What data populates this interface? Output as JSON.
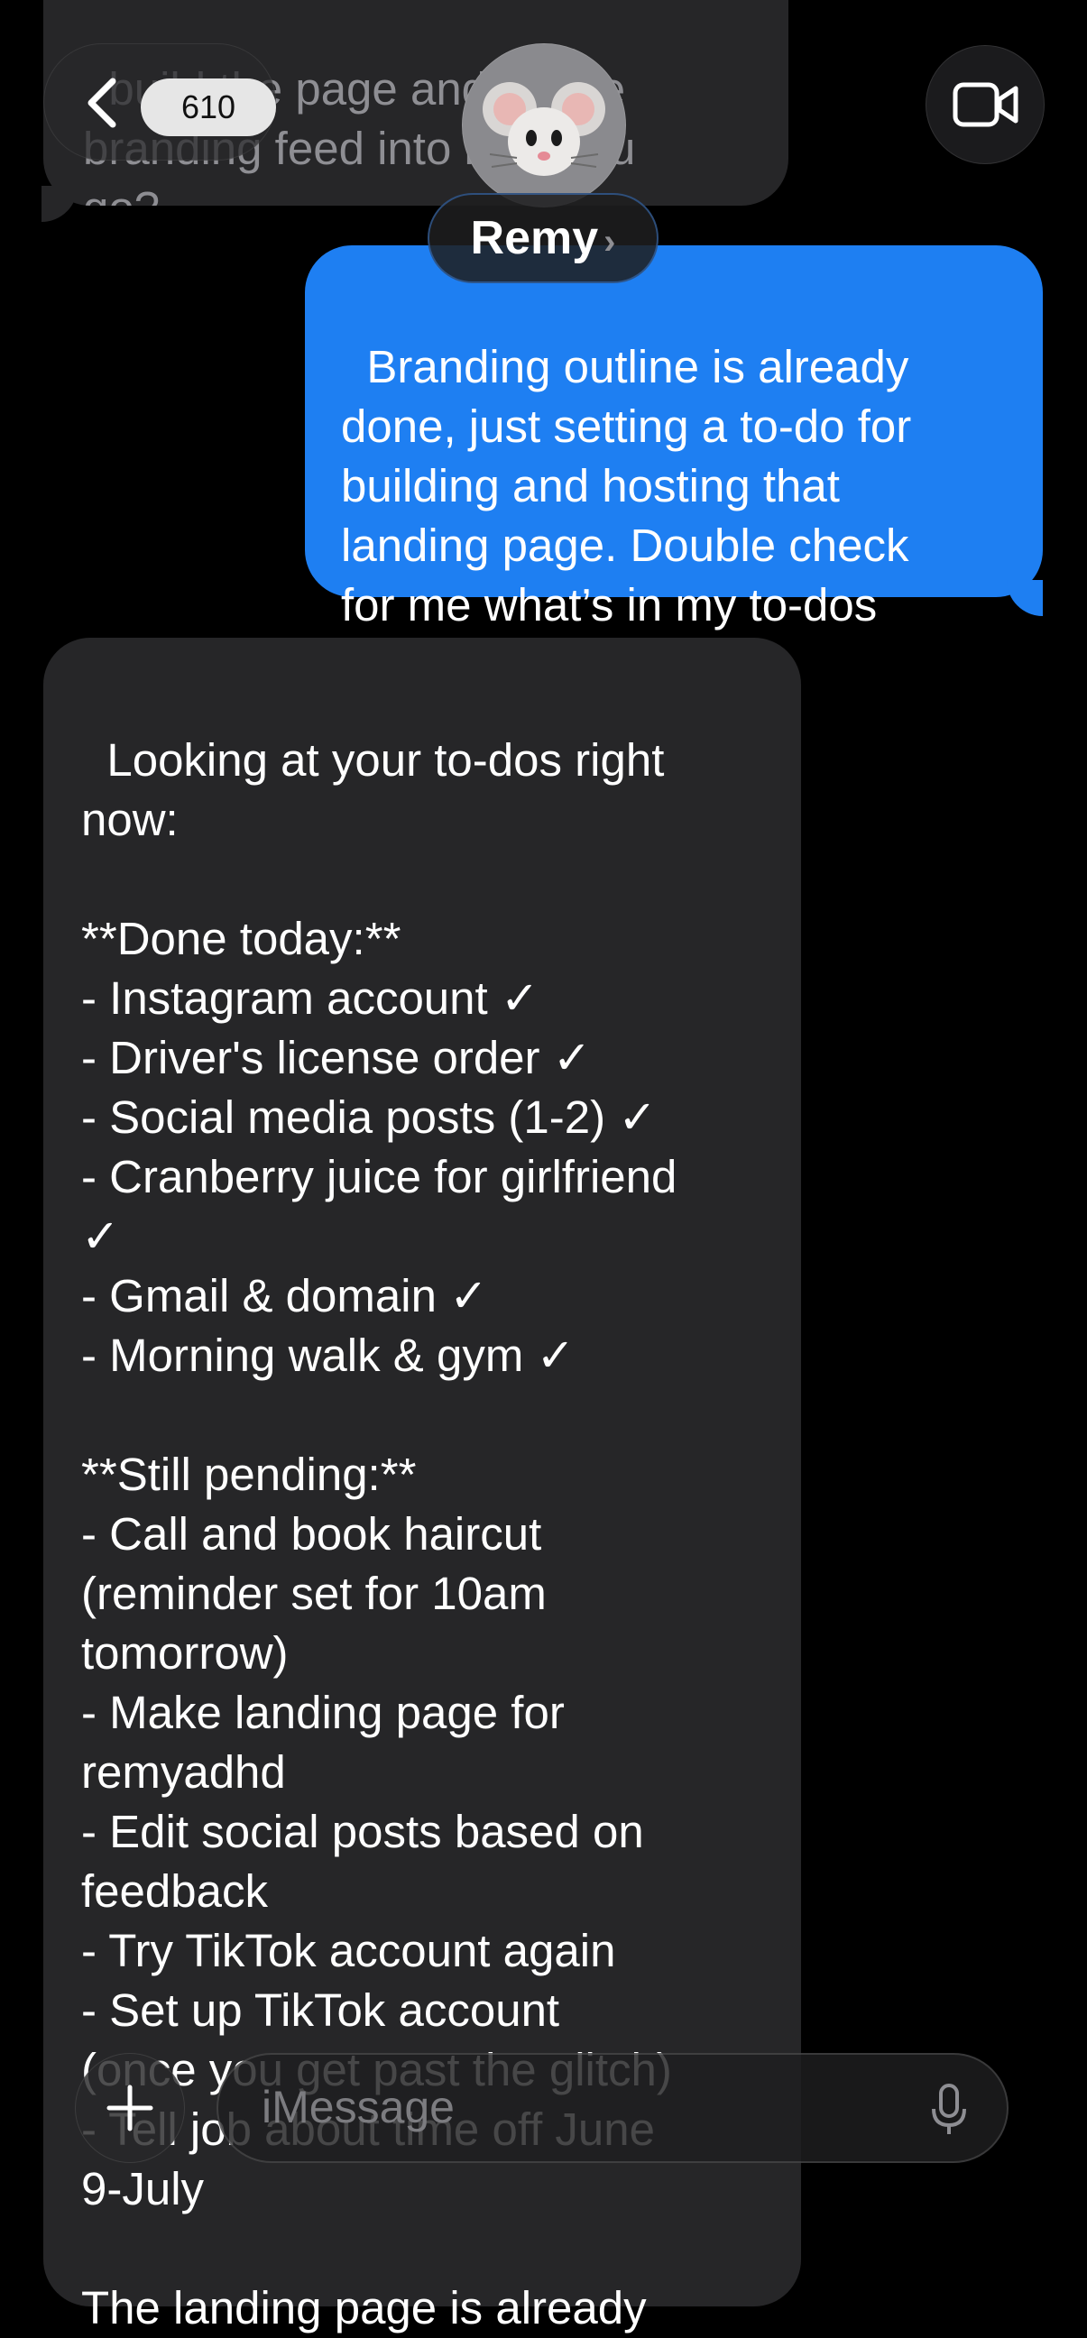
{
  "header": {
    "back_label": "<",
    "unread_count": "610",
    "contact_name": "Remy",
    "contact_chevron": "›",
    "avatar_icon": "mouse-avatar",
    "video_icon": "video-camera-icon"
  },
  "messages": [
    {
      "sender": "contact",
      "text": "build the page and let the\nbranding feed into it as you\ngo?"
    },
    {
      "sender": "me",
      "text": "Branding outline is already\ndone, just setting a to-do for\nbuilding and hosting that\nlanding page. Double check\nfor me what’s in my to-dos"
    },
    {
      "sender": "contact",
      "text": "Looking at your to-dos right\nnow:\n\n**Done today:**\n- Instagram account ✓\n- Driver's license order ✓\n- Social media posts (1-2) ✓\n- Cranberry juice for girlfriend\n✓\n- Gmail & domain ✓\n- Morning walk & gym ✓\n\n**Still pending:**\n- Call and book haircut\n(reminder set for 10am\ntomorrow)\n- Make landing page for\nremyadhd\n- Edit social posts based on\nfeedback\n- Try TikTok account again\n- Set up TikTok account\n(once you get past the glitch)\n- Tell job about time off June\n9-July\n\nThe landing page is already"
    }
  ],
  "composer": {
    "placeholder": "iMessage",
    "plus_icon": "plus-icon",
    "mic_icon": "microphone-icon"
  },
  "colors": {
    "outgoing": "#1e7ff2",
    "incoming": "#262628",
    "background": "#000000"
  }
}
